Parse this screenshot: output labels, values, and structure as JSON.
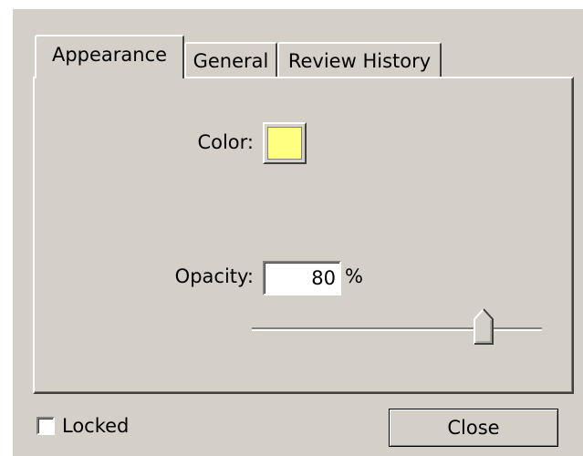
{
  "tabs": [
    {
      "label": "Appearance",
      "active": true
    },
    {
      "label": "General",
      "active": false
    },
    {
      "label": "Review History",
      "active": false
    }
  ],
  "appearance": {
    "color_label": "Color:",
    "color_value": "#ffff80",
    "opacity_label": "Opacity:",
    "opacity_value": "80",
    "opacity_unit": "%",
    "opacity_slider_fraction": 0.8
  },
  "footer": {
    "locked_label": "Locked",
    "locked_checked": false,
    "close_label": "Close"
  }
}
